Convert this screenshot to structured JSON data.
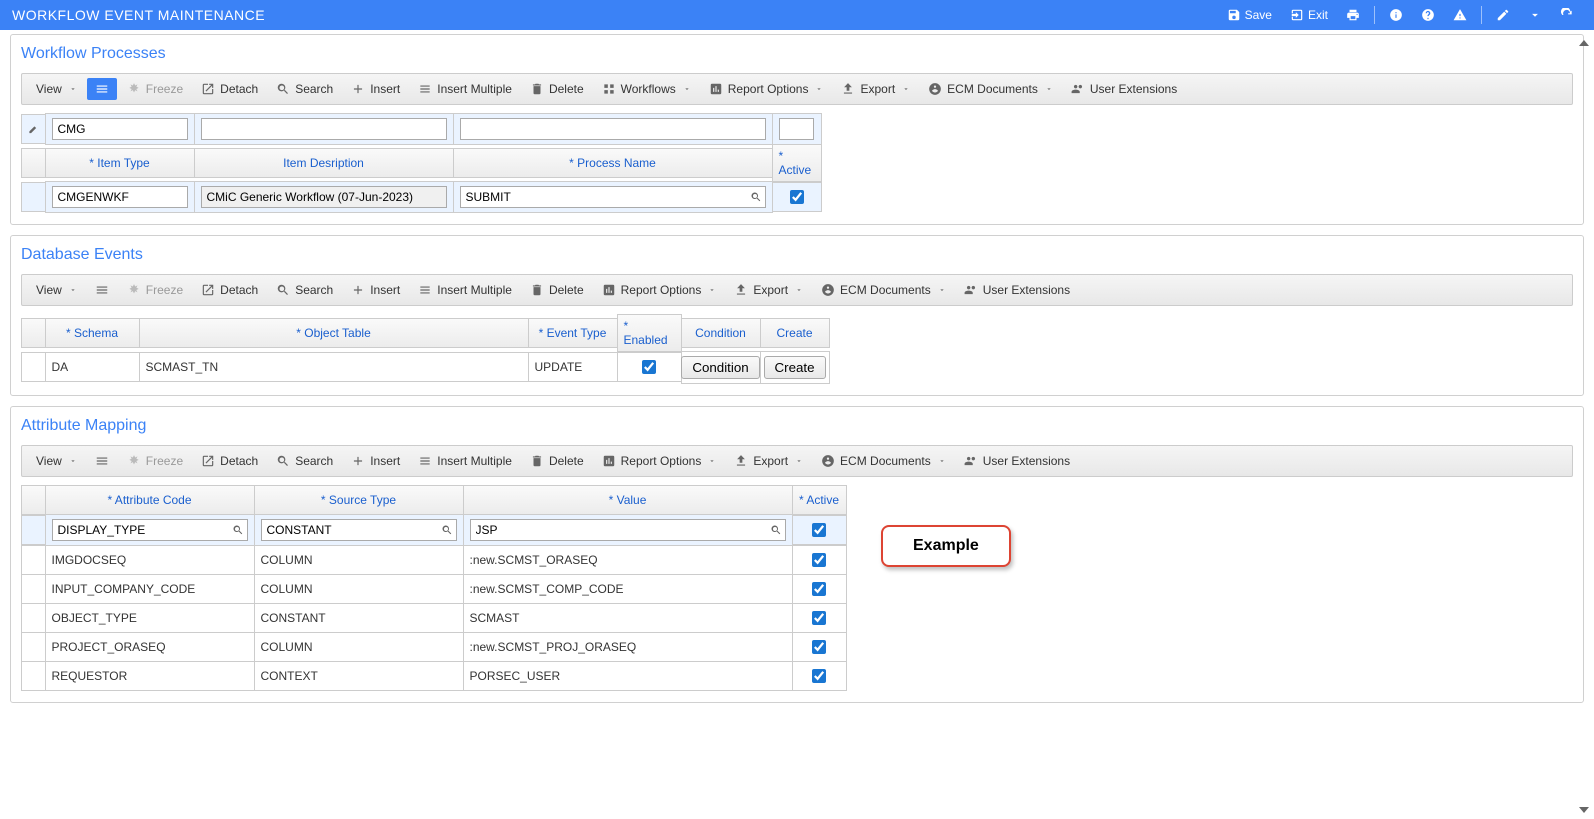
{
  "header": {
    "title": "WORKFLOW EVENT MAINTENANCE",
    "save": "Save",
    "exit": "Exit"
  },
  "toolbar_labels": {
    "view": "View",
    "freeze": "Freeze",
    "detach": "Detach",
    "search": "Search",
    "insert": "Insert",
    "insert_multiple": "Insert Multiple",
    "delete": "Delete",
    "workflows": "Workflows",
    "report_options": "Report Options",
    "export": "Export",
    "ecm_documents": "ECM Documents",
    "user_extensions": "User Extensions"
  },
  "workflow_processes": {
    "title": "Workflow Processes",
    "filter": {
      "item_type": "CMG",
      "item_description": "",
      "process_name": "",
      "active": ""
    },
    "columns": {
      "item_type": "* Item Type",
      "item_description": "Item Desription",
      "process_name": "* Process Name",
      "active": "* Active"
    },
    "row": {
      "item_type": "CMGENWKF",
      "item_description": "CMiC Generic Workflow (07-Jun-2023)",
      "process_name": "SUBMIT",
      "active": true
    }
  },
  "database_events": {
    "title": "Database Events",
    "columns": {
      "schema": "* Schema",
      "object_table": "* Object Table",
      "event_type": "* Event Type",
      "enabled": "* Enabled",
      "condition": "Condition",
      "create": "Create"
    },
    "row": {
      "schema": "DA",
      "object_table": "SCMAST_TN",
      "event_type": "UPDATE",
      "enabled": true,
      "condition_btn": "Condition",
      "create_btn": "Create"
    }
  },
  "attribute_mapping": {
    "title": "Attribute Mapping",
    "columns": {
      "attribute_code": "* Attribute Code",
      "source_type": "* Source Type",
      "value": "* Value",
      "active": "* Active"
    },
    "rows": [
      {
        "attribute_code": "DISPLAY_TYPE",
        "source_type": "CONSTANT",
        "value": "JSP",
        "active": true,
        "selected": true
      },
      {
        "attribute_code": "IMGDOCSEQ",
        "source_type": "COLUMN",
        "value": ":new.SCMST_ORASEQ",
        "active": true
      },
      {
        "attribute_code": "INPUT_COMPANY_CODE",
        "source_type": "COLUMN",
        "value": ":new.SCMST_COMP_CODE",
        "active": true
      },
      {
        "attribute_code": "OBJECT_TYPE",
        "source_type": "CONSTANT",
        "value": "SCMAST",
        "active": true
      },
      {
        "attribute_code": "PROJECT_ORASEQ",
        "source_type": "COLUMN",
        "value": ":new.SCMST_PROJ_ORASEQ",
        "active": true
      },
      {
        "attribute_code": "REQUESTOR",
        "source_type": "CONTEXT",
        "value": "PORSEC_USER",
        "active": true
      }
    ]
  },
  "callout": "Example"
}
